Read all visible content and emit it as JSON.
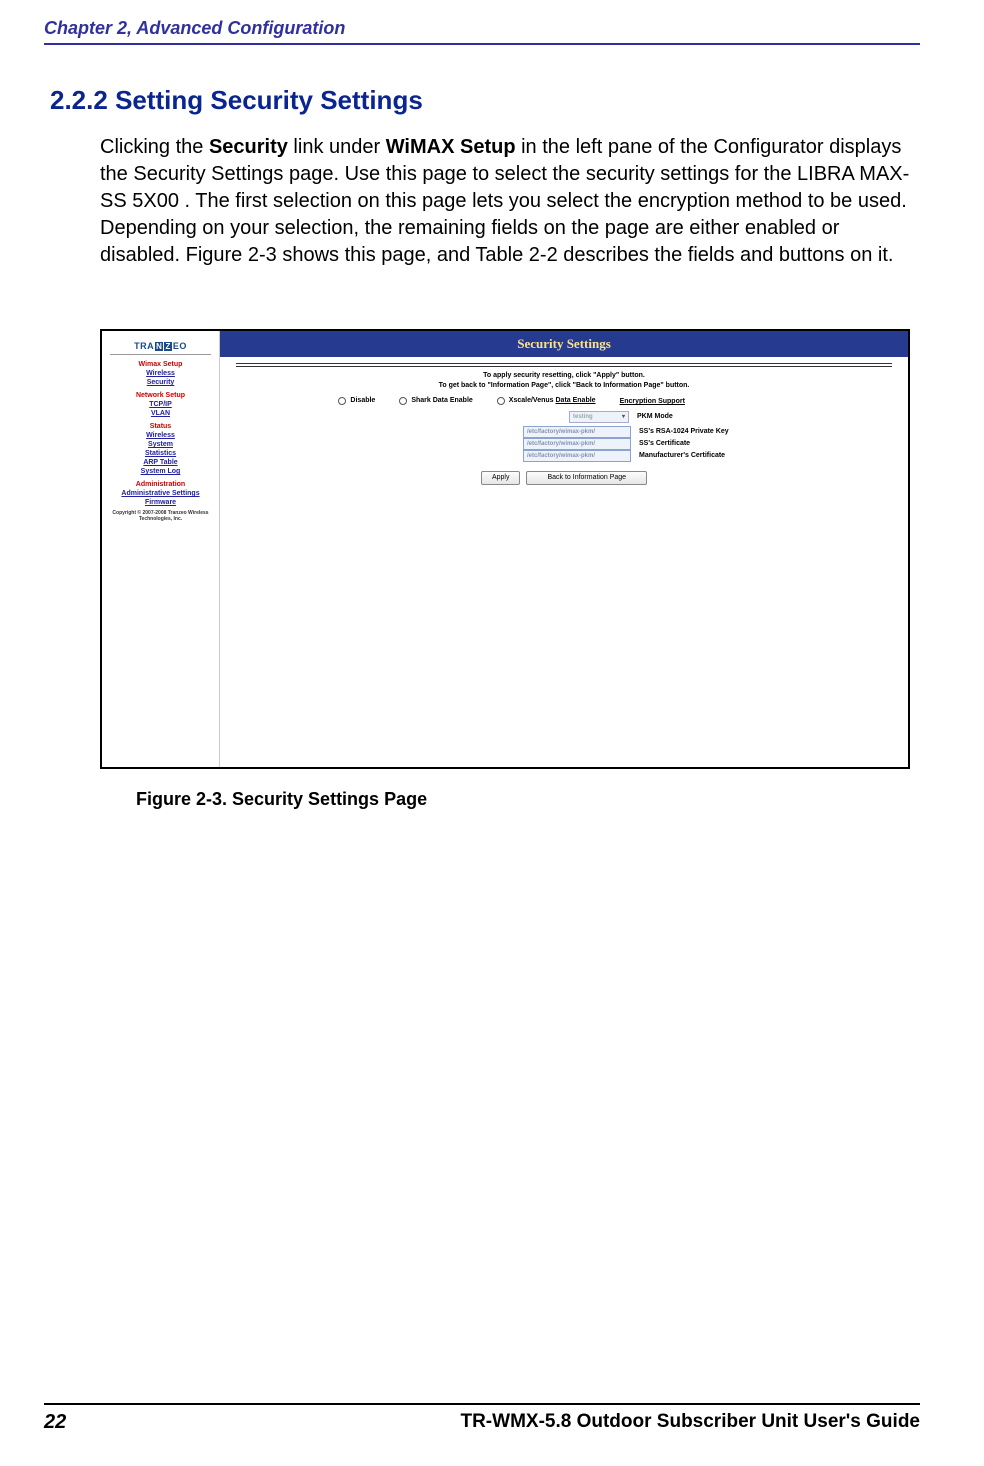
{
  "header": {
    "chapter": "Chapter 2, Advanced Configuration"
  },
  "section": {
    "number": "2.2.2",
    "title": "Setting Security Settings",
    "body_html": "Clicking the <b>Security</b> link under <b>WiMAX Setup</b> in the left pane of the Configurator displays the Security Settings page. Use this page to select the security settings for the LIBRA MAX-SS 5X00 . The first selection on this page lets you select the encryption method to be used. Depending on your selection, the remaining fields on the page are either enabled or disabled. Figure 2-3 shows this page, and Table 2-2 describes the fields and buttons on it."
  },
  "figure": {
    "caption": "Figure 2-3. Security Settings Page",
    "sidebar": {
      "logo_parts": [
        "TRA",
        "N",
        "Z",
        "EO"
      ],
      "groups": [
        {
          "title": "Wimax Setup",
          "links": [
            "Wireless",
            "Security"
          ]
        },
        {
          "title": "Network Setup",
          "links": [
            "TCP/IP",
            "VLAN"
          ]
        },
        {
          "title": "Status",
          "links": [
            "Wireless",
            "System",
            "Statistics",
            "ARP Table",
            "System Log"
          ]
        },
        {
          "title": "Administration",
          "links": [
            "Administrative Settings",
            "Firmware"
          ]
        }
      ],
      "copyright": "Copyright © 2007-2008 Tranzeo Wireless Technologies, Inc."
    },
    "content": {
      "title": "Security Settings",
      "instructions": [
        "To apply security resetting, click \"Apply\" button.",
        "To get back to \"Information Page\", click \"Back to Information Page\" button."
      ],
      "radios": [
        {
          "label": "Disable"
        },
        {
          "label": "Shark Data Enable"
        },
        {
          "label": "Xscale/Venus Data Enable",
          "underline": "Data Enable"
        }
      ],
      "enc_support_header": "Encryption Support",
      "mode": {
        "value": "testing",
        "label": "PKM Mode"
      },
      "fields": [
        {
          "value": "/etc/factory/wimax-pkm/",
          "label": "SS's RSA-1024 Private Key"
        },
        {
          "value": "/etc/factory/wimax-pkm/",
          "label": "SS's Certificate"
        },
        {
          "value": "/etc/factory/wimax-pkm/",
          "label": "Manufacturer's Certificate"
        }
      ],
      "buttons": {
        "apply": "Apply",
        "back": "Back to Information Page"
      }
    }
  },
  "footer": {
    "page": "22",
    "guide": "TR-WMX-5.8 Outdoor Subscriber Unit User's Guide"
  }
}
